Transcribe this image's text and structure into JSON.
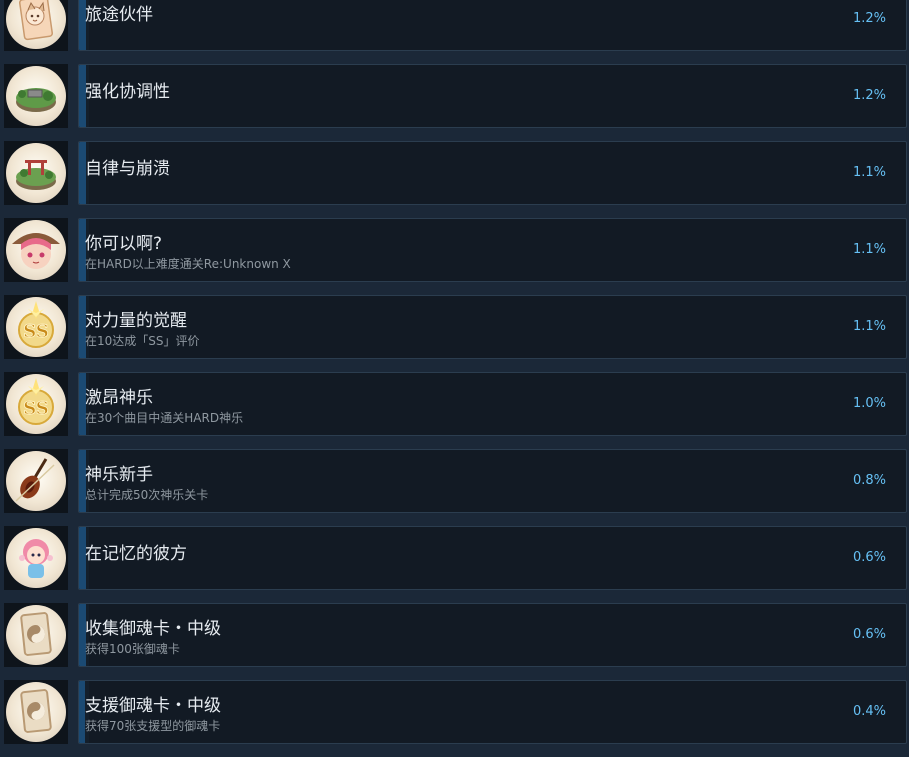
{
  "achievements": [
    {
      "title": "旅途伙伴",
      "desc": "",
      "pct": "1.2%",
      "progress": 0.012,
      "icon": "card-character-icon"
    },
    {
      "title": "强化协调性",
      "desc": "",
      "pct": "1.2%",
      "progress": 0.012,
      "icon": "island-icon"
    },
    {
      "title": "自律与崩溃",
      "desc": "",
      "pct": "1.1%",
      "progress": 0.011,
      "icon": "island-gate-icon"
    },
    {
      "title": "你可以啊?",
      "desc": "在HARD以上难度通关Re:Unknown X",
      "pct": "1.1%",
      "progress": 0.011,
      "icon": "character-face-icon"
    },
    {
      "title": "对力量的觉醒",
      "desc": "在10达成「SS」评价",
      "pct": "1.1%",
      "progress": 0.011,
      "icon": "ss-rank-icon"
    },
    {
      "title": "激昂神乐",
      "desc": "在30个曲目中通关HARD神乐",
      "pct": "1.0%",
      "progress": 0.01,
      "icon": "ss-rank-icon"
    },
    {
      "title": "神乐新手",
      "desc": "总计完成50次神乐关卡",
      "pct": "0.8%",
      "progress": 0.008,
      "icon": "violin-icon"
    },
    {
      "title": "在记忆的彼方",
      "desc": "",
      "pct": "0.6%",
      "progress": 0.006,
      "icon": "chibi-character-icon"
    },
    {
      "title": "收集御魂卡・中级",
      "desc": "获得100张御魂卡",
      "pct": "0.6%",
      "progress": 0.006,
      "icon": "yin-yang-card-icon"
    },
    {
      "title": "支援御魂卡・中级",
      "desc": "获得70张支援型的御魂卡",
      "pct": "0.4%",
      "progress": 0.004,
      "icon": "yin-yang-card-icon"
    }
  ],
  "colors": {
    "background": "#1b2838",
    "card": "#121a24",
    "progress_fill": "#1b4a73",
    "percent_text": "#66c0f4"
  }
}
